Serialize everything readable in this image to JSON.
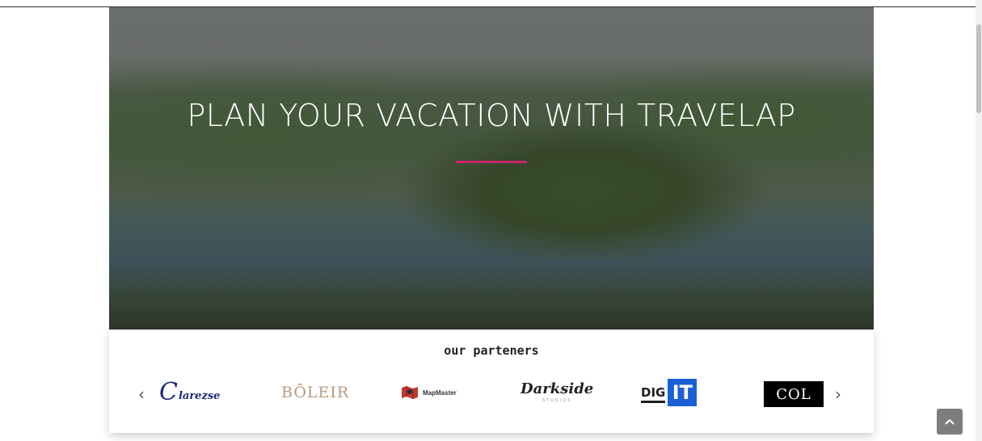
{
  "hero": {
    "title": "PLAN YOUR VACATION WITH TRAVELAP",
    "accent_color": "#c8246b"
  },
  "partners": {
    "heading": "our parteners",
    "prev_icon": "chevron-left-icon",
    "next_icon": "chevron-right-icon",
    "prev_glyph": "‹",
    "next_glyph": "›",
    "logos": [
      {
        "id": "clarezse",
        "initial": "C",
        "text": "larezse",
        "color": "#1e2a78"
      },
      {
        "id": "boleir",
        "text": "BŌLEIR",
        "color": "#b89a80"
      },
      {
        "id": "mapmaster",
        "text": "MapMaster",
        "icon": "map-marker-icon"
      },
      {
        "id": "darkside",
        "text": "Darkside",
        "sub": "STUDIOS"
      },
      {
        "id": "digit",
        "text_a": "DIG",
        "text_b": "IT",
        "color": "#1a5fd6"
      },
      {
        "id": "col",
        "text": "COL"
      }
    ]
  },
  "back_to_top": {
    "icon": "chevron-up-icon"
  }
}
